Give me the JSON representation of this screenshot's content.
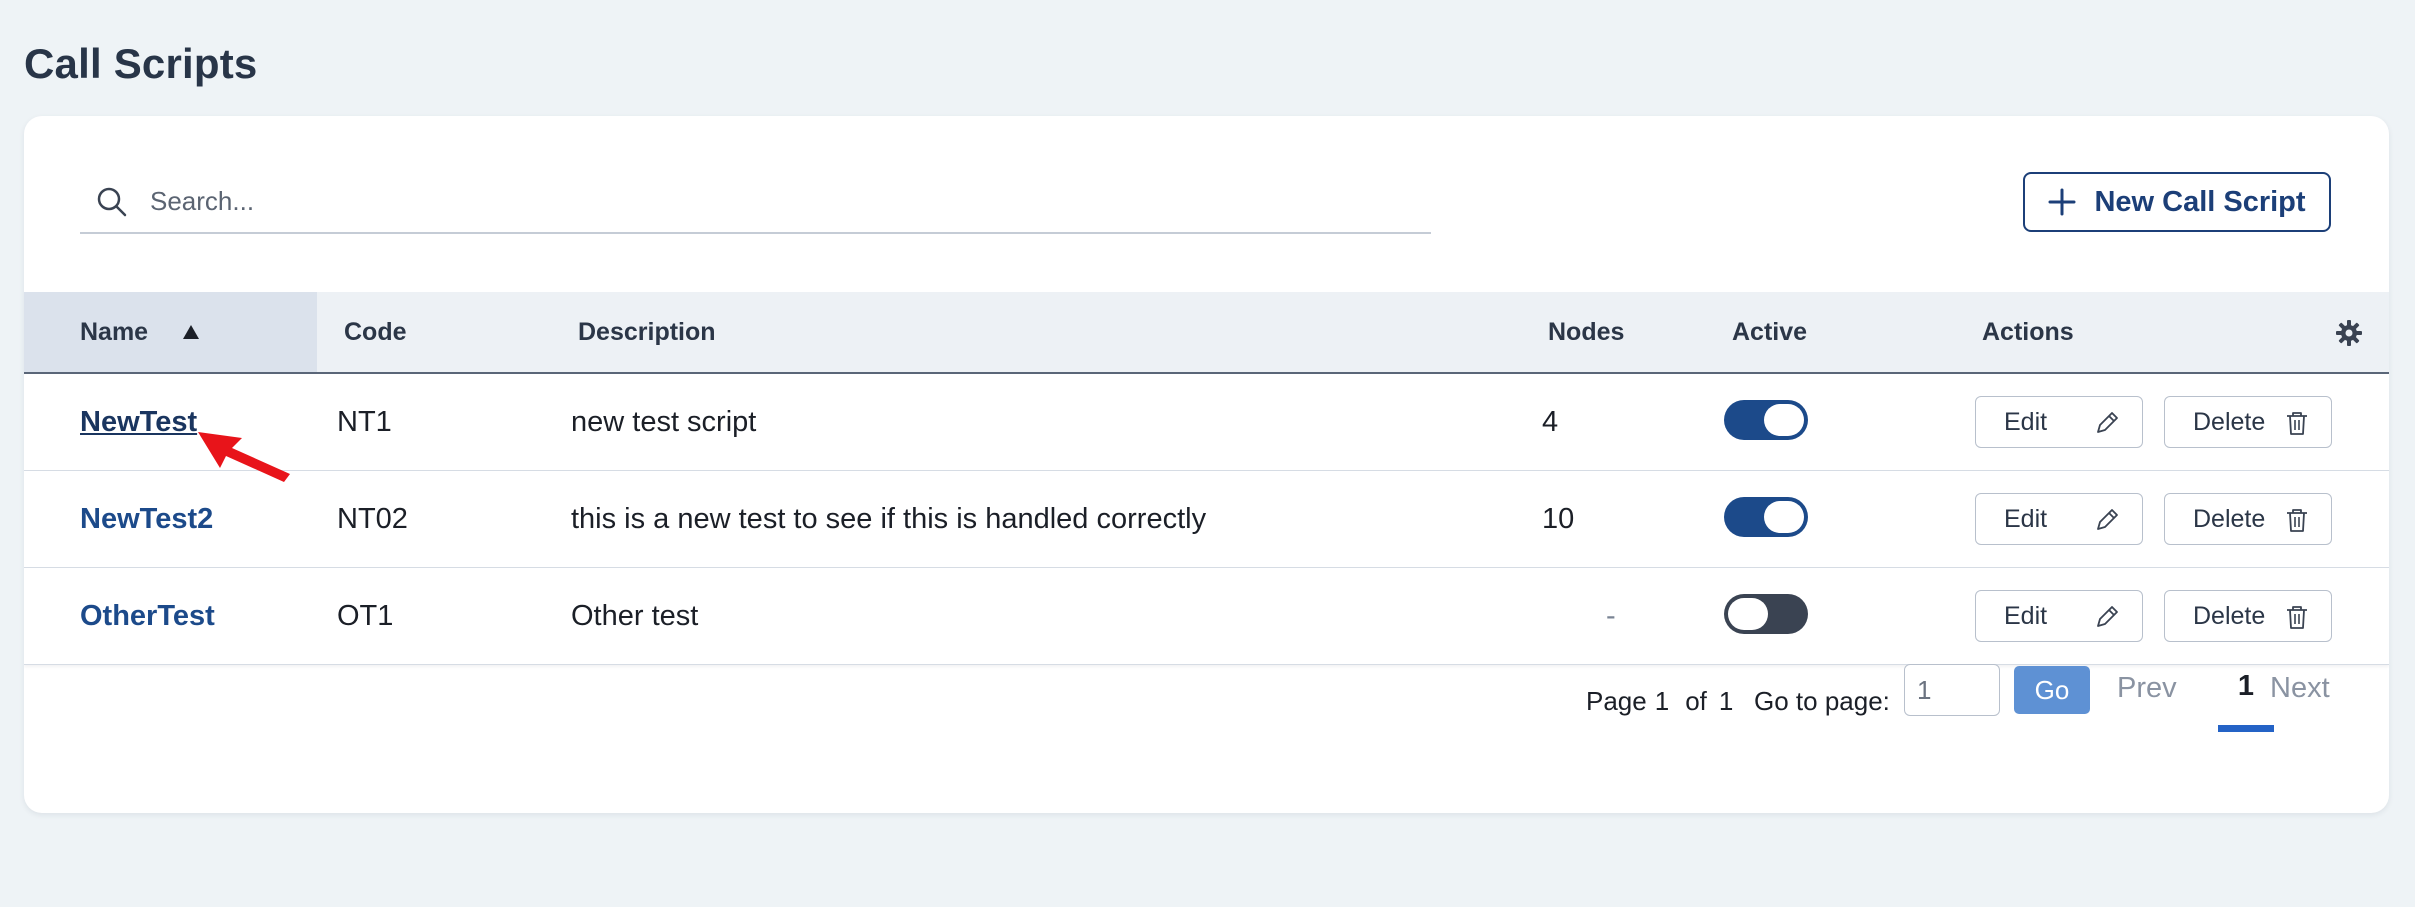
{
  "page": {
    "title": "Call Scripts"
  },
  "toolbar": {
    "search_placeholder": "Search...",
    "new_button_label": "New Call Script"
  },
  "table": {
    "columns": {
      "name": "Name",
      "code": "Code",
      "description": "Description",
      "nodes": "Nodes",
      "active": "Active",
      "actions": "Actions"
    },
    "rows": [
      {
        "name": "NewTest",
        "code": "NT1",
        "description": "new test script",
        "nodes": "4",
        "active": true
      },
      {
        "name": "NewTest2",
        "code": "NT02",
        "description": "this is a new test to see if this is handled correctly",
        "nodes": "10",
        "active": true
      },
      {
        "name": "OtherTest",
        "code": "OT1",
        "description": "Other test",
        "nodes": "-",
        "active": false
      }
    ],
    "edit_label": "Edit",
    "delete_label": "Delete"
  },
  "pagination": {
    "page_word": "Page",
    "current": "1",
    "of_word": "of",
    "total": "1",
    "goto_label": "Go to page:",
    "goto_value": "1",
    "go_label": "Go",
    "prev_label": "Prev",
    "page_number": "1",
    "next_label": "Next"
  },
  "colors": {
    "accent": "#1c4a8a",
    "toggle_off": "#3a4352",
    "go_button": "#5e91d4",
    "pointer_arrow": "#e8141a"
  }
}
